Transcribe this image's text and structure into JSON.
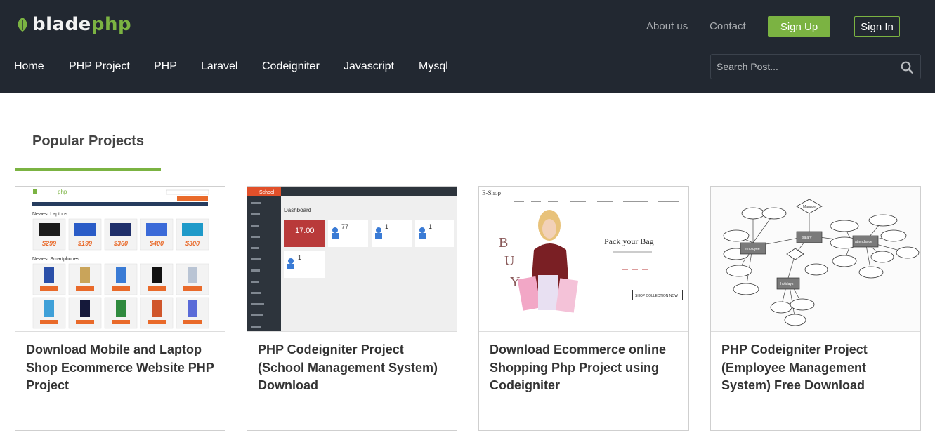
{
  "brand": {
    "part1": "blade",
    "part2": "php"
  },
  "toplinks": {
    "about": "About us",
    "contact": "Contact"
  },
  "auth": {
    "signup": "Sign Up",
    "signin": "Sign In"
  },
  "nav": [
    "Home",
    "PHP Project",
    "PHP",
    "Laravel",
    "Codeigniter",
    "Javascript",
    "Mysql"
  ],
  "search": {
    "placeholder": "Search Post..."
  },
  "section": {
    "title": "Popular Projects"
  },
  "cards": [
    {
      "title": "Download Mobile and Laptop Shop Ecommerce Website PHP Project",
      "thumb": {
        "brand": "php",
        "heading1": "Newest Laptops",
        "heading2": "Newest Smartphones",
        "prices": [
          "$299",
          "$199",
          "$360",
          "$400",
          "$300"
        ]
      }
    },
    {
      "title": "PHP Codeigniter Project (School Management System) Download",
      "thumb": {
        "app": "School",
        "page": "Dashboard",
        "stat1": "17.00",
        "stat2": "77",
        "stat3": "1",
        "stat4": "1",
        "stat5": "1"
      }
    },
    {
      "title": "Download Ecommerce online Shopping Php Project using Codeigniter",
      "thumb": {
        "brand": "E-Shop",
        "headline": "Pack your Bag",
        "cta": "SHOP COLLECTION NOW",
        "letters": [
          "B",
          "U",
          "Y"
        ]
      }
    },
    {
      "title": "PHP Codeigniter Project (Employee Management System) Free Download",
      "thumb": {
        "entities": [
          "employee",
          "salary",
          "attendance",
          "holidays"
        ],
        "relation": "Manage"
      }
    }
  ],
  "colors": {
    "header_bg": "#222831",
    "accent": "#7bb342"
  }
}
